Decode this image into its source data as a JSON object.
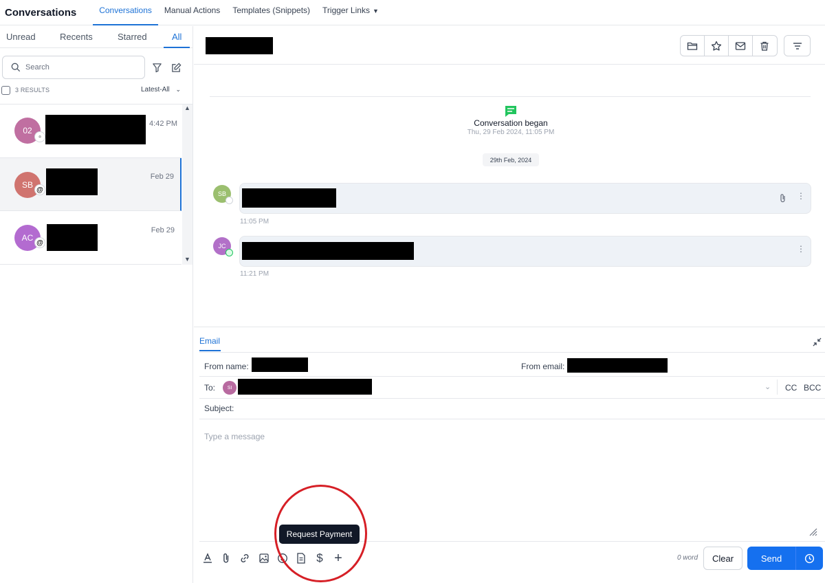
{
  "topnav": {
    "app_title": "Conversations",
    "tabs": [
      "Conversations",
      "Manual Actions",
      "Templates (Snippets)",
      "Trigger Links"
    ]
  },
  "left": {
    "filter_tabs": [
      "Unread",
      "Recents",
      "Starred",
      "All"
    ],
    "search_placeholder": "Search",
    "results_label": "3 RESULTS",
    "sort_label": "Latest-All",
    "conversations": [
      {
        "initials": "02",
        "time": "4:42 PM",
        "color": "#c06fa1"
      },
      {
        "initials": "SB",
        "time": "Feb 29",
        "color": "#d0746f"
      },
      {
        "initials": "AC",
        "time": "Feb 29",
        "color": "#b36bd0"
      }
    ]
  },
  "timeline": {
    "began_title": "Conversation began",
    "began_date": "Thu, 29 Feb 2024, 11:05 PM",
    "date_pill": "29th Feb, 2024",
    "messages": [
      {
        "initials": "SB",
        "time": "11:05 PM",
        "color": "#9bbf6f"
      },
      {
        "initials": "JC",
        "time": "11:21 PM",
        "color": "#b270c8"
      }
    ]
  },
  "composer": {
    "tab": "Email",
    "from_name_label": "From name:",
    "from_email_label": "From email:",
    "to_label": "To:",
    "to_avatar_initials": "SI",
    "cc": "CC",
    "bcc": "BCC",
    "subject_label": "Subject:",
    "message_placeholder": "Type a message",
    "word_count": "0 word",
    "clear_label": "Clear",
    "send_label": "Send",
    "tooltip": "Request Payment"
  }
}
